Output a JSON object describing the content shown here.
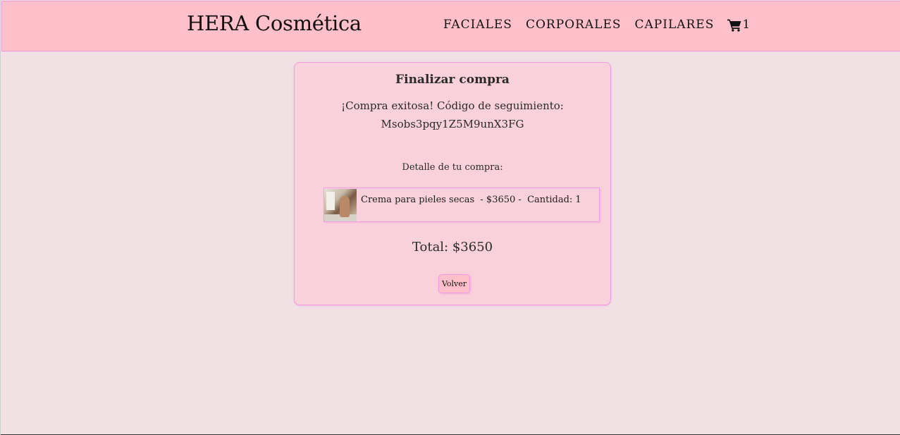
{
  "header": {
    "brand": "HERA Cosmética",
    "nav": [
      {
        "label": "FACIALES"
      },
      {
        "label": "CORPORALES"
      },
      {
        "label": "CAPILARES"
      }
    ],
    "cart": {
      "icon": "shopping-cart-icon",
      "count": "1"
    }
  },
  "checkout": {
    "title": "Finalizar compra",
    "success_message": "¡Compra exitosa! Código de seguimiento:",
    "tracking_code": "Msobs3pqy1Z5M9unX3FG",
    "detail_heading": "Detalle de tu compra:",
    "items": [
      {
        "image": "product-thumbnail",
        "text": "Crema para pieles secas  - $3650 -  Cantidad: 1"
      }
    ],
    "total": "Total: $3650",
    "back_label": "Volver"
  },
  "colors": {
    "page_bg": "#f1e1e5",
    "navbar_bg": "#ffc0cb",
    "card_bg": "#f9d1db",
    "accent_border": "#f39ae3"
  }
}
